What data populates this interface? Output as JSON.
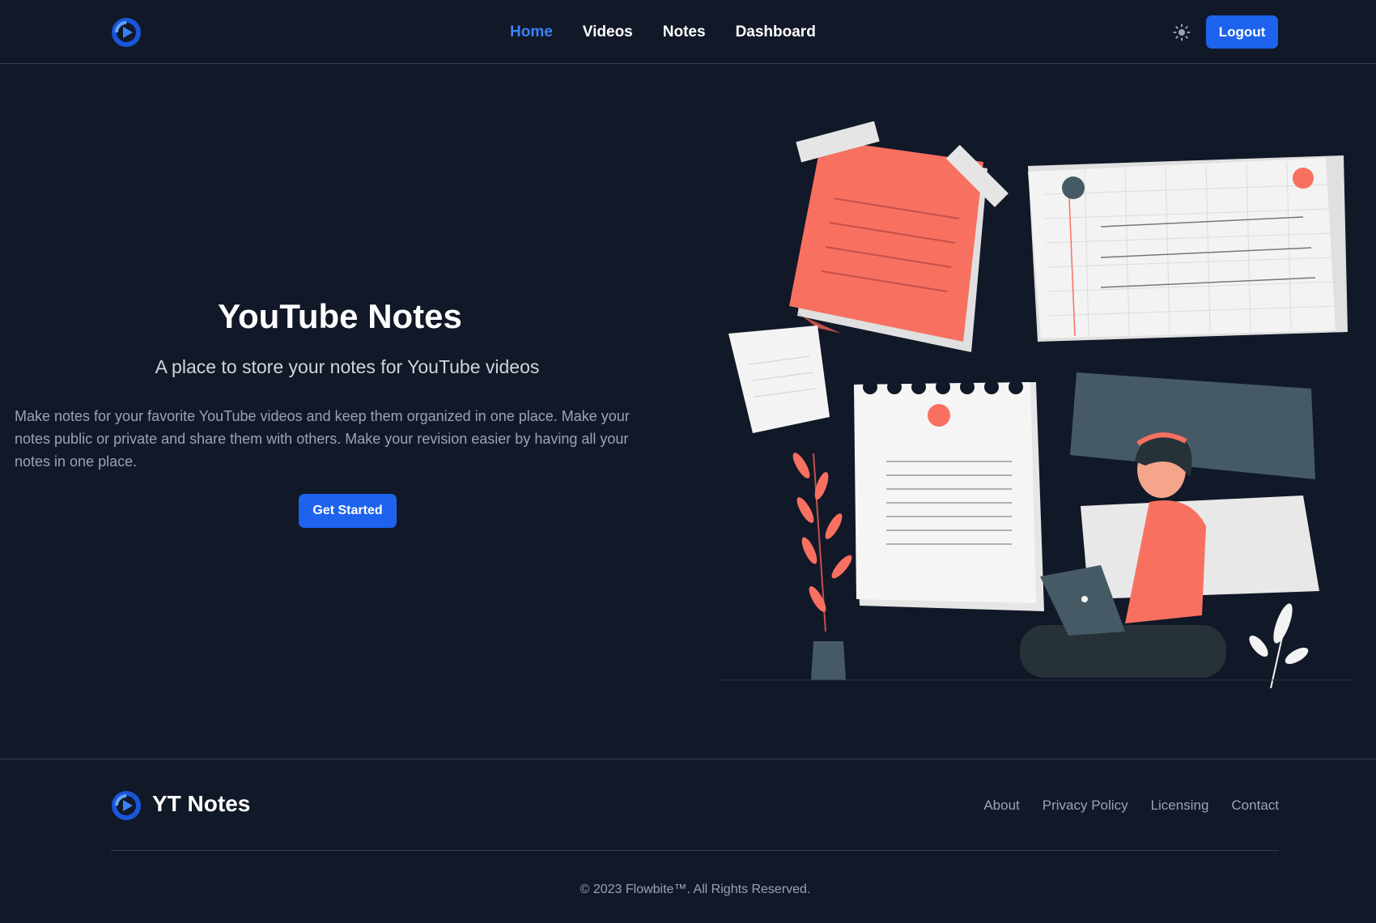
{
  "nav": {
    "links": [
      {
        "label": "Home",
        "active": true
      },
      {
        "label": "Videos",
        "active": false
      },
      {
        "label": "Notes",
        "active": false
      },
      {
        "label": "Dashboard",
        "active": false
      }
    ],
    "theme_icon": "sun-icon",
    "logout_label": "Logout"
  },
  "hero": {
    "title": "YouTube Notes",
    "subtitle": "A place to store your notes for YouTube videos",
    "body": "Make notes for your favorite YouTube videos and keep them organized in one place. Make your notes public or private and share them with others. Make your revision easier by having all your notes in one place.",
    "cta_label": "Get Started"
  },
  "footer": {
    "brand": "YT Notes",
    "links": [
      "About",
      "Privacy Policy",
      "Licensing",
      "Contact"
    ],
    "copyright": "© 2023 Flowbite™. All Rights Reserved."
  },
  "colors": {
    "background": "#111827",
    "accent": "#1d63ed",
    "active_link": "#3b82f6",
    "coral": "#f87060"
  }
}
